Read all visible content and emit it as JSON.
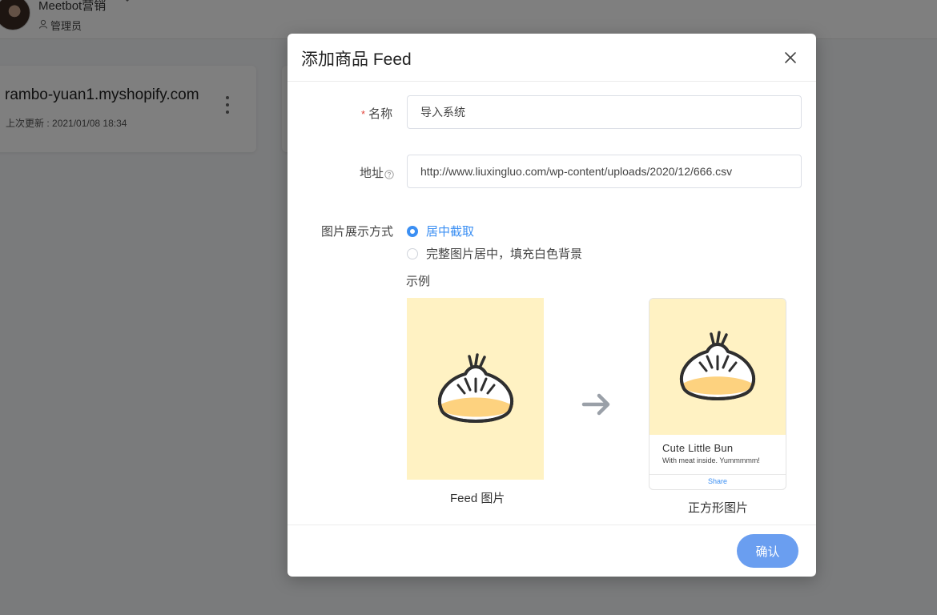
{
  "header": {
    "account_name": "Meetbot营销",
    "role": "管理员",
    "icons": {
      "chevron": "chevron-down-icon",
      "role": "user-icon"
    }
  },
  "shop_card": {
    "domain": "rambo-yuan1.myshopify.com",
    "last_updated_label": "上次更新 :",
    "last_updated_value": "2021/01/08 18:34"
  },
  "modal": {
    "title": "添加商品 Feed",
    "name_label": "名称",
    "name_value": "导入系统",
    "address_label": "地址",
    "address_value": "http://www.liuxingluo.com/wp-content/uploads/2020/12/666.csv",
    "display_mode_label": "图片展示方式",
    "options": [
      {
        "label": "居中截取",
        "checked": true
      },
      {
        "label": "完整图片居中，填充白色背景",
        "checked": false
      }
    ],
    "example_title": "示例",
    "feed_caption": "Feed 图片",
    "square_caption": "正方形图片",
    "preview_card": {
      "title": "Cute Little Bun",
      "subtitle": "With meat inside. Yummmmm!",
      "share": "Share"
    },
    "confirm_label": "确认"
  },
  "colors": {
    "accent": "#3b8ff3",
    "confirm_button": "#6a9ef0",
    "required": "#e2453c",
    "image_bg": "#fff2c3",
    "overlay": "rgba(0,0,0,0.5)"
  }
}
